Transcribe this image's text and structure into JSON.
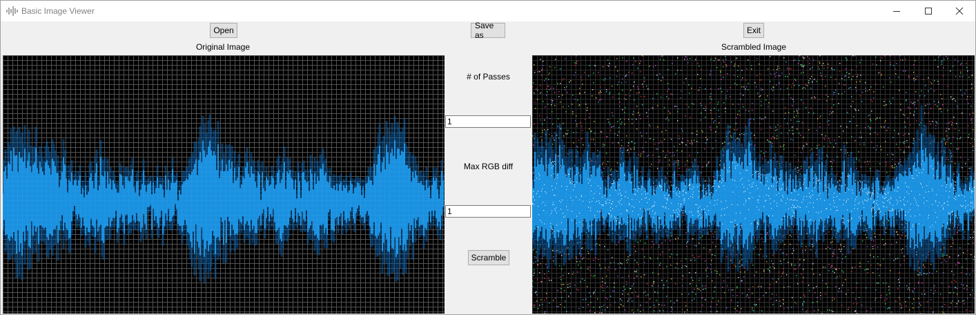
{
  "window": {
    "title": "Basic Image Viewer",
    "controls": [
      "minimize",
      "maximize",
      "close"
    ]
  },
  "toolbar": {
    "open_label": "Open",
    "save_as_label": "Save as",
    "exit_label": "Exit"
  },
  "original": {
    "caption": "Original Image"
  },
  "scrambled": {
    "caption": "Scrambled Image"
  },
  "controls": {
    "passes_label": "# of Passes",
    "passes_value": "1",
    "max_rgb_label": "Max RGB diff",
    "max_rgb_value": "1",
    "scramble_label": "Scramble"
  },
  "colors": {
    "waveform": "#1fa8ff",
    "waveform_glow": "#0a5ea8",
    "grid_background": "#000000",
    "grid_lines": "#6f6f6f",
    "window_bg": "#f0f0f0"
  },
  "icons": {
    "app": "waveform-icon",
    "minimize": "minimize-icon",
    "maximize": "maximize-icon",
    "close": "close-icon"
  }
}
